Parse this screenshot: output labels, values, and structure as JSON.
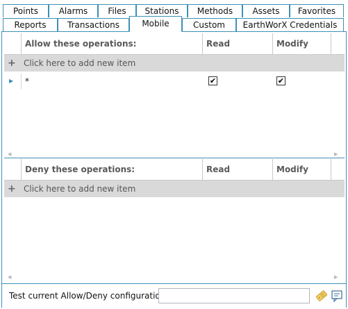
{
  "tabs": {
    "row1": [
      {
        "label": "Points"
      },
      {
        "label": "Alarms"
      },
      {
        "label": "Files"
      },
      {
        "label": "Stations"
      },
      {
        "label": "Methods"
      },
      {
        "label": "Assets"
      },
      {
        "label": "Favorites"
      }
    ],
    "row2": [
      {
        "label": "Reports"
      },
      {
        "label": "Transactions"
      },
      {
        "label": "Mobile",
        "active": true
      },
      {
        "label": "Custom"
      },
      {
        "label": "EarthWorX Credentials"
      }
    ]
  },
  "allow": {
    "columns": [
      "Allow these operations:",
      "Read",
      "Modify"
    ],
    "add_text": "Click here to add new item",
    "rows": [
      {
        "operation": "*",
        "read": "✔",
        "modify": "✔"
      }
    ]
  },
  "deny": {
    "columns": [
      "Deny these operations:",
      "Read",
      "Modify"
    ],
    "add_text": "Click here to add new item",
    "rows": []
  },
  "test": {
    "label": "Test current Allow/Deny configuration:",
    "value": "",
    "test_icon": "ticket-icon",
    "notes_icon": "comment-icon"
  }
}
